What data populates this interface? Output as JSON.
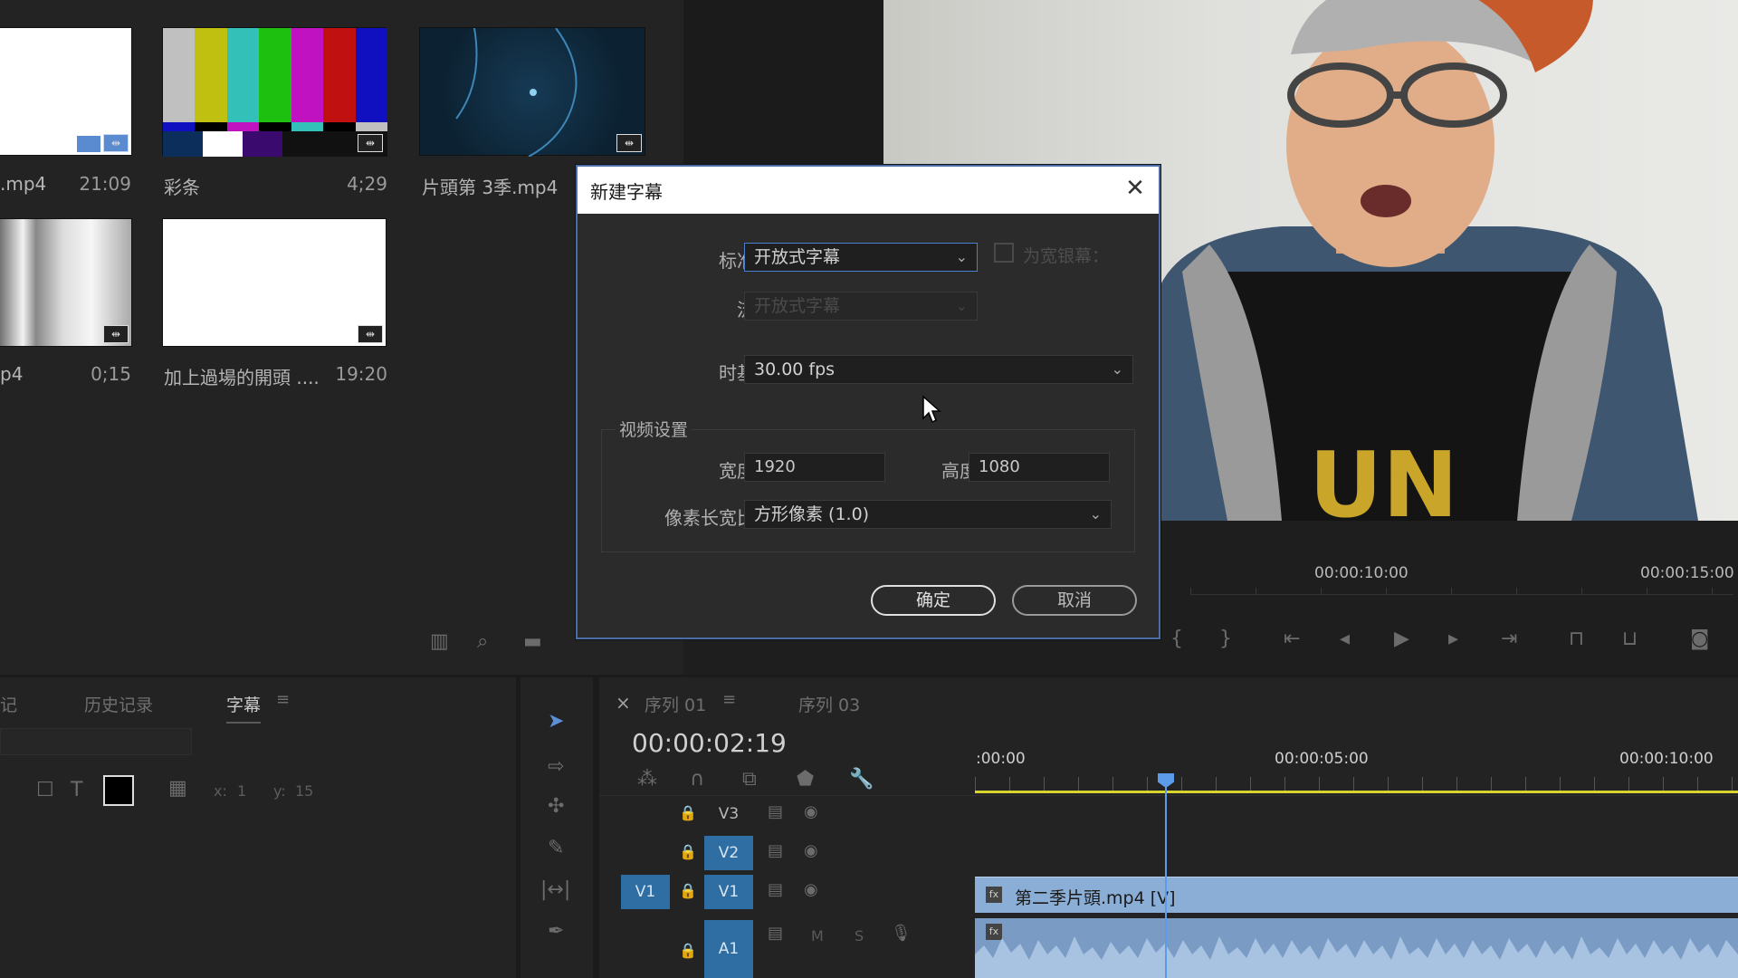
{
  "project_panel": {
    "items": [
      {
        "label": ".mp4",
        "duration": "21:09"
      },
      {
        "label": "彩条",
        "duration": "4;29"
      },
      {
        "label": "片頭第 3季.mp4",
        "duration": ""
      },
      {
        "label": "p4",
        "duration": "0;15"
      },
      {
        "label": "加上過場的開頭 ....",
        "duration": "19:20"
      }
    ]
  },
  "program_monitor": {
    "ruler_marks": [
      "00:00:10:00",
      "00:00:15:00"
    ]
  },
  "left_bottom": {
    "tabs": [
      "记",
      "历史记录",
      "字幕"
    ],
    "coords": {
      "x_label": "x:",
      "x_val": "1",
      "y_label": "y:",
      "y_val": "15"
    }
  },
  "timeline": {
    "tabs": [
      "序列 01",
      "序列 03"
    ],
    "close_icon": "×",
    "timecode": "00:00:02:19",
    "ruler_marks": [
      ":00:00",
      "00:00:05:00",
      "00:00:10:00"
    ],
    "tracks": [
      {
        "name": "V3"
      },
      {
        "name": "V2"
      },
      {
        "name": "V1",
        "source": "V1"
      },
      {
        "name": "A1",
        "mute": "M",
        "solo": "S"
      }
    ],
    "clip_label": "第二季片頭.mp4 [V]"
  },
  "dialog": {
    "title": "新建字幕",
    "standard_label": "标准：",
    "standard_value": "开放式字幕",
    "widescreen_label": "为宽银幕：",
    "stream_label": "流：",
    "stream_value": "开放式字幕",
    "timebase_label": "时基：",
    "timebase_value": "30.00 fps",
    "video_settings_label": "视频设置",
    "width_label": "宽度：",
    "width_value": "1920",
    "height_label": "高度：",
    "height_value": "1080",
    "par_label": "像素长宽比：",
    "par_value": "方形像素 (1.0)",
    "ok_label": "确定",
    "cancel_label": "取消"
  },
  "colors": {
    "accent": "#4a6da8",
    "clip_video": "#8aaed6",
    "clip_audio": "#7a9bc4",
    "playhead": "#5b9bea",
    "work_area": "#d8d430",
    "track_selected": "#2f6ea3"
  }
}
